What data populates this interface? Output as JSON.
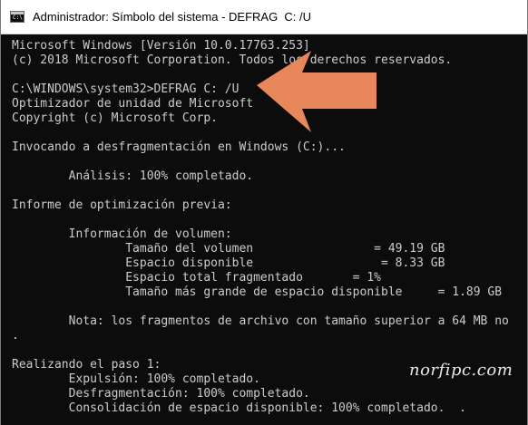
{
  "window": {
    "title": "Administrador: Símbolo del sistema - DEFRAG  C: /U",
    "icon": "cmd-icon"
  },
  "console": {
    "lines": [
      "Microsoft Windows [Versión 10.0.17763.253]",
      "(c) 2018 Microsoft Corporation. Todos los derechos reservados.",
      "",
      "C:\\WINDOWS\\system32>DEFRAG C: /U",
      "Optimizador de unidad de Microsoft",
      "Copyright (c) Microsoft Corp.",
      "",
      "Invocando a desfragmentación en Windows (C:)...",
      "",
      "        Análisis: 100% completado.",
      "",
      "Informe de optimización previa:",
      "",
      "        Información de volumen:",
      "                Tamaño del volumen                 = 49.19 GB",
      "                Espacio disponible                  = 8.33 GB",
      "                Espacio total fragmentado       = 1%",
      "                Tamaño más grande de espacio disponible     = 1.89 GB",
      "",
      "        Nota: los fragmentos de archivo con tamaño superior a 64 MB no",
      ".",
      "",
      "Realizando el paso 1:",
      "        Expulsión: 100% completado.",
      "        Desfragmentación: 100% completado.",
      "        Consolidación de espacio disponible: 100% completado.  ."
    ]
  },
  "annotation": {
    "arrow_color": "#e8875a"
  },
  "watermark": {
    "text": "norfipc.com"
  },
  "colors": {
    "console_bg": "#0c0c0c",
    "console_text": "#cccccc",
    "titlebar_bg": "#ffffff"
  }
}
